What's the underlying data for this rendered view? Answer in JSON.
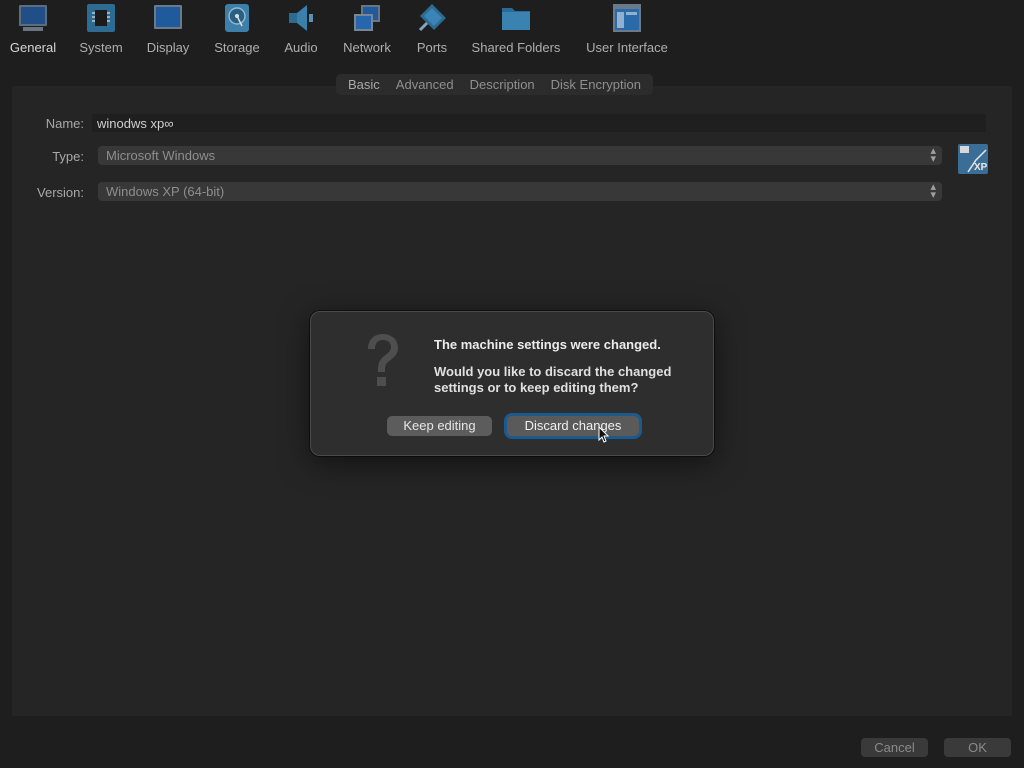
{
  "toolbar": {
    "items": [
      {
        "label": "General",
        "icon": "monitor-icon"
      },
      {
        "label": "System",
        "icon": "chip-icon"
      },
      {
        "label": "Display",
        "icon": "display-icon"
      },
      {
        "label": "Storage",
        "icon": "disk-icon"
      },
      {
        "label": "Audio",
        "icon": "speaker-icon"
      },
      {
        "label": "Network",
        "icon": "network-icon"
      },
      {
        "label": "Ports",
        "icon": "ports-icon"
      },
      {
        "label": "Shared Folders",
        "icon": "folder-icon"
      },
      {
        "label": "User Interface",
        "icon": "window-icon"
      }
    ]
  },
  "tabs": [
    "Basic",
    "Advanced",
    "Description",
    "Disk Encryption"
  ],
  "form": {
    "name_label": "Name:",
    "name_value": "winodws xp∞",
    "type_label": "Type:",
    "type_value": "Microsoft Windows",
    "version_label": "Version:",
    "version_value": "Windows XP (64-bit)",
    "os_badge": "XP"
  },
  "dialog": {
    "title": "The machine settings were changed.",
    "body": "Would you like to discard the changed settings or to keep editing them?",
    "keep_label": "Keep editing",
    "discard_label": "Discard changes"
  },
  "footer": {
    "cancel_label": "Cancel",
    "ok_label": "OK"
  },
  "colors": {
    "accent": "#1d5a8c",
    "background": "#1e1e1e"
  }
}
